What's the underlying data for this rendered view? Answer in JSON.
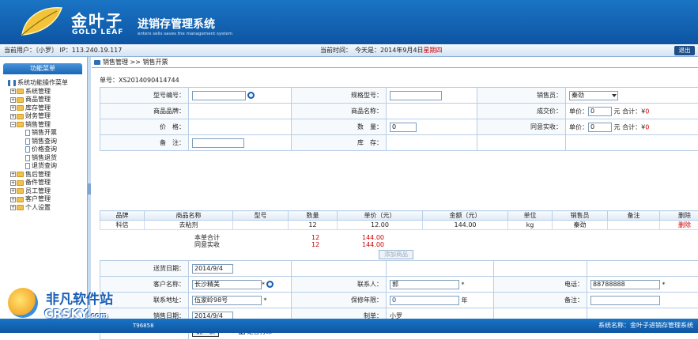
{
  "header": {
    "brand_cn": "金叶子",
    "brand_en": "GOLD LEAF",
    "system_title": "进销存管理系统",
    "system_subtitle": "enters sells saves the management system"
  },
  "userbar": {
    "current_user": "当前用户：〔小罗〕 IP：113.240.19.117",
    "time_label": "当前时间：　今天是：2014年9月4日",
    "weekday": "星期四",
    "logout_label": "退出"
  },
  "sidebar": {
    "header": "功能菜单",
    "root": "系统功能操作菜单",
    "items": [
      {
        "label": "系统管理",
        "expanded": false
      },
      {
        "label": "商品管理",
        "expanded": false
      },
      {
        "label": "库存管理",
        "expanded": false
      },
      {
        "label": "财务管理",
        "expanded": false
      },
      {
        "label": "销售管理",
        "expanded": true
      },
      {
        "label": "售后管理",
        "expanded": false
      },
      {
        "label": "备件管理",
        "expanded": false
      },
      {
        "label": "员工管理",
        "expanded": false
      },
      {
        "label": "客户管理",
        "expanded": false
      },
      {
        "label": "个人设置",
        "expanded": false
      }
    ],
    "sales_children": [
      "销售开票",
      "销售查询",
      "价格查询",
      "销售退货",
      "退货查询"
    ]
  },
  "breadcrumb": {
    "text": "销售管理 >> 销售开票"
  },
  "order_no": "单号：XS2014090414744",
  "form1": {
    "model_no_label": "型号编号：",
    "model_no_value": "",
    "spec_label": "规格型号：",
    "spec_value": "",
    "salesman_label": "销售员：",
    "salesman_value": "秦劲",
    "brand_label": "商品品牌：",
    "name_label": "商品名称：",
    "deal_price_label": "成交价：",
    "unit_price_label": "单价：",
    "deal_unit_value": "0",
    "yuan": "元",
    "total_label": "合计：",
    "yen": "¥",
    "deal_total": "0",
    "price_label": "价　格：",
    "qty_label": "数　量：",
    "qty_value": "0",
    "agreed_label": "同意实收：",
    "agreed_unit_value": "0",
    "agreed_total": "0",
    "remark_label": "备　注：",
    "remark_value": "",
    "stock_label": "库　存："
  },
  "grid": {
    "headers": [
      "品牌",
      "商品名称",
      "型号",
      "数量",
      "单价（元）",
      "金额（元）",
      "单位",
      "销售员",
      "备注",
      "删除"
    ],
    "rows": [
      {
        "brand": "科信",
        "name": "去粘剂",
        "model": "",
        "qty": "12",
        "price": "12.00",
        "amount": "144.00",
        "unit": "kg",
        "salesman": "秦劲",
        "remark": "",
        "delete": "删除"
      }
    ]
  },
  "totals": {
    "subtotal_label": "本单合计",
    "subtotal_qty": "12",
    "subtotal_amount": "144.00",
    "agreed_label": "同意实收",
    "agreed_qty": "12",
    "agreed_amount": "144.00"
  },
  "add_button": "添加商品",
  "form2": {
    "ship_date_label": "送货日期：",
    "ship_date_value": "2014/9/4",
    "customer_label": "客户名称：",
    "customer_value": "长沙精美",
    "star": "*",
    "contact_label": "联系人：",
    "contact_value": "郭",
    "phone_label": "电话：",
    "phone_value": "88788888",
    "address_label": "联系地址：",
    "address_value": "伍家岭98号",
    "warranty_label": "保修年限：",
    "warranty_value": "0",
    "year": "年",
    "remark_label": "备注：",
    "remark_value": "",
    "sale_date_label": "销售日期：",
    "sale_date_value": "2014/9/4",
    "maker_label": "制单：",
    "maker_value": "小罗",
    "confirm_label": "确　认",
    "print_label": "是否打印",
    "print_checked": true
  },
  "footer": {
    "contact": "T96858",
    "system_name": "系统名称：金叶子进销存管理系统"
  },
  "watermark": {
    "cn": "非凡软件站",
    "en": "CRSKY",
    "en_suffix": ".com"
  }
}
